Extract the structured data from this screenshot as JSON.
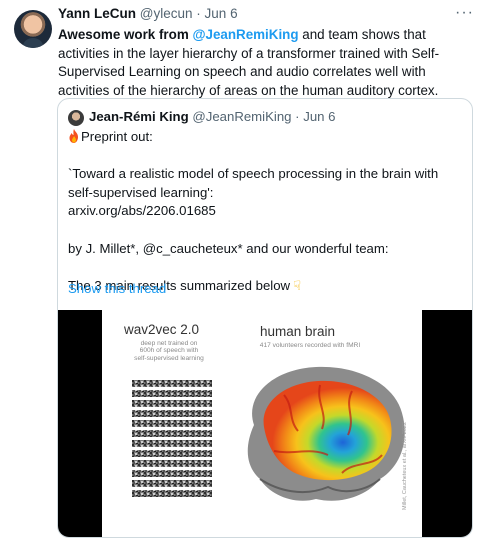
{
  "author": {
    "name": "Yann LeCun",
    "handle": "@ylecun",
    "separator": "·",
    "date": "Jun 6"
  },
  "more_icon": "more-horizontal-icon",
  "tweet": {
    "lead": "Awesome work from ",
    "mention": "@JeanRemiKing",
    "rest": " and team shows that activities in the layer hierarchy of a transformer trained with Self-Supervised Learning on speech and audio correlates well with activities of the hierarchy of areas on the human auditory cortex."
  },
  "quote": {
    "name": "Jean-Rémi King",
    "handle": "@JeanRemiKing",
    "separator": "·",
    "date": "Jun 6",
    "preprint": "Preprint out:",
    "title_line": "`Toward a realistic model of speech processing in the brain with self-supervised learning':",
    "link": "arxiv.org/abs/2206.01685",
    "authors": "by J. Millet*, @c_caucheteux* and our wonderful team:",
    "summary": "The 3 main results summarized below",
    "show_thread": "Show this thread"
  },
  "figure": {
    "left_title": "wav2vec 2.0",
    "left_sub_1": "deep net trained on",
    "left_sub_2": "600h of speech with",
    "left_sub_3": "self-supervised learning",
    "right_title": "human brain",
    "right_sub": "417 volunteers recorded with fMRI",
    "credit": "Millet, Caucheteux et al., arXiv 2022"
  },
  "colors": {
    "link": "#1d9bf0",
    "muted": "#536471",
    "border": "#cfd9de"
  }
}
